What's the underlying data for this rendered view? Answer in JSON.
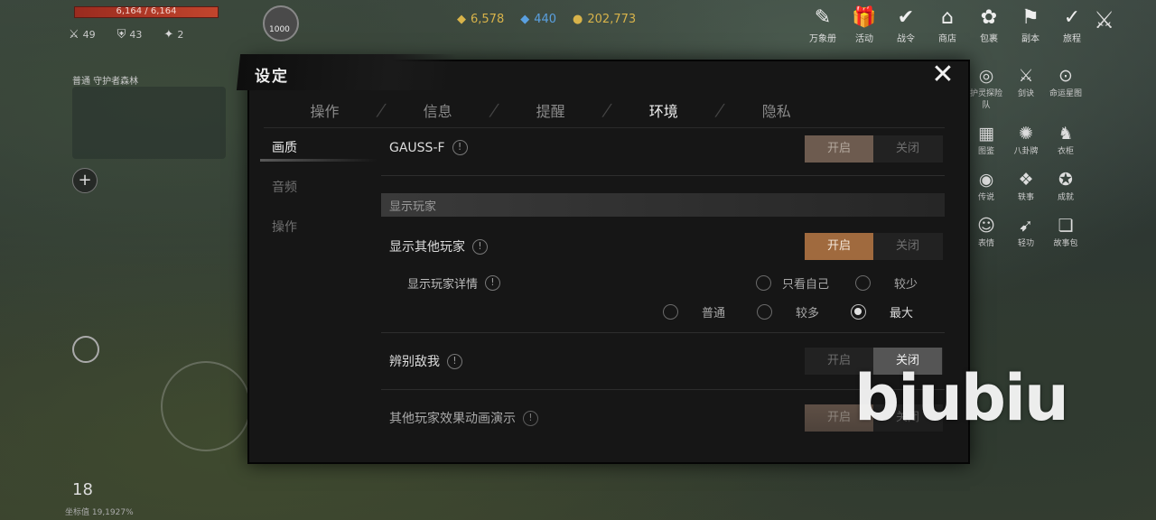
{
  "hud": {
    "hp_text": "6,164 / 6,164",
    "stats": [
      {
        "icon": "⚔",
        "value": "49"
      },
      {
        "icon": "⛨",
        "value": "43"
      },
      {
        "icon": "✦",
        "value": "2"
      }
    ],
    "avatar_level": "1000",
    "currency": [
      {
        "icon": "◆",
        "value": "6,578",
        "class": "gold"
      },
      {
        "icon": "◆",
        "value": "440",
        "class": "blue"
      },
      {
        "icon": "●",
        "value": "202,773",
        "class": "gold"
      }
    ],
    "top_icons": [
      {
        "glyph": "✎",
        "label": "万象册"
      },
      {
        "glyph": "🎁",
        "label": "活动"
      },
      {
        "glyph": "✔",
        "label": "战令"
      },
      {
        "glyph": "⌂",
        "label": "商店"
      },
      {
        "glyph": "✿",
        "label": "包裹"
      },
      {
        "glyph": "⚑",
        "label": "副本"
      },
      {
        "glyph": "✓",
        "label": "旅程"
      }
    ],
    "top_close_glyph": "⚔",
    "side_icons": [
      {
        "glyph": "◎",
        "label": "护灵探险队"
      },
      {
        "glyph": "⚔",
        "label": "剑诀"
      },
      {
        "glyph": "⊙",
        "label": "命运星图"
      },
      {
        "glyph": "▦",
        "label": "图鉴"
      },
      {
        "glyph": "✺",
        "label": "八卦牌"
      },
      {
        "glyph": "♞",
        "label": "衣柜"
      },
      {
        "glyph": "◉",
        "label": "传说"
      },
      {
        "glyph": "❖",
        "label": "轶事"
      },
      {
        "glyph": "✪",
        "label": "成就"
      },
      {
        "glyph": "☺",
        "label": "表情"
      },
      {
        "glyph": "➹",
        "label": "轻功"
      },
      {
        "glyph": "❏",
        "label": "故事包"
      }
    ],
    "minimap_label": "普通  守护者森林",
    "time": "18",
    "coords": "坐标值 19,1927%",
    "watermark": "biubiu"
  },
  "dialog": {
    "title": "设定",
    "tabs": [
      {
        "label": "操作",
        "active": false
      },
      {
        "label": "信息",
        "active": false
      },
      {
        "label": "提醒",
        "active": false
      },
      {
        "label": "环境",
        "active": true
      },
      {
        "label": "隐私",
        "active": false
      }
    ],
    "sidenav": [
      {
        "label": "画质",
        "active": true
      },
      {
        "label": "音频",
        "active": false
      },
      {
        "label": "操作",
        "active": false
      }
    ],
    "toggle_on_label": "开启",
    "toggle_off_label": "关闭",
    "gauss": {
      "label": "GAUSS-F",
      "value": "on"
    },
    "section_show_players": "显示玩家",
    "show_others": {
      "label": "显示其他玩家",
      "value": "on"
    },
    "player_detail": {
      "label": "显示玩家详情",
      "options": [
        "只看自己",
        "较少",
        "普通",
        "较多",
        "最大"
      ],
      "selected": "最大"
    },
    "friend_foe": {
      "label": "辨别敌我",
      "value": "off"
    },
    "others_effects": {
      "label": "其他玩家效果动画演示",
      "value": "on"
    }
  },
  "colors": {
    "accent_on": "#a06a3e",
    "off_selected": "#555555"
  }
}
